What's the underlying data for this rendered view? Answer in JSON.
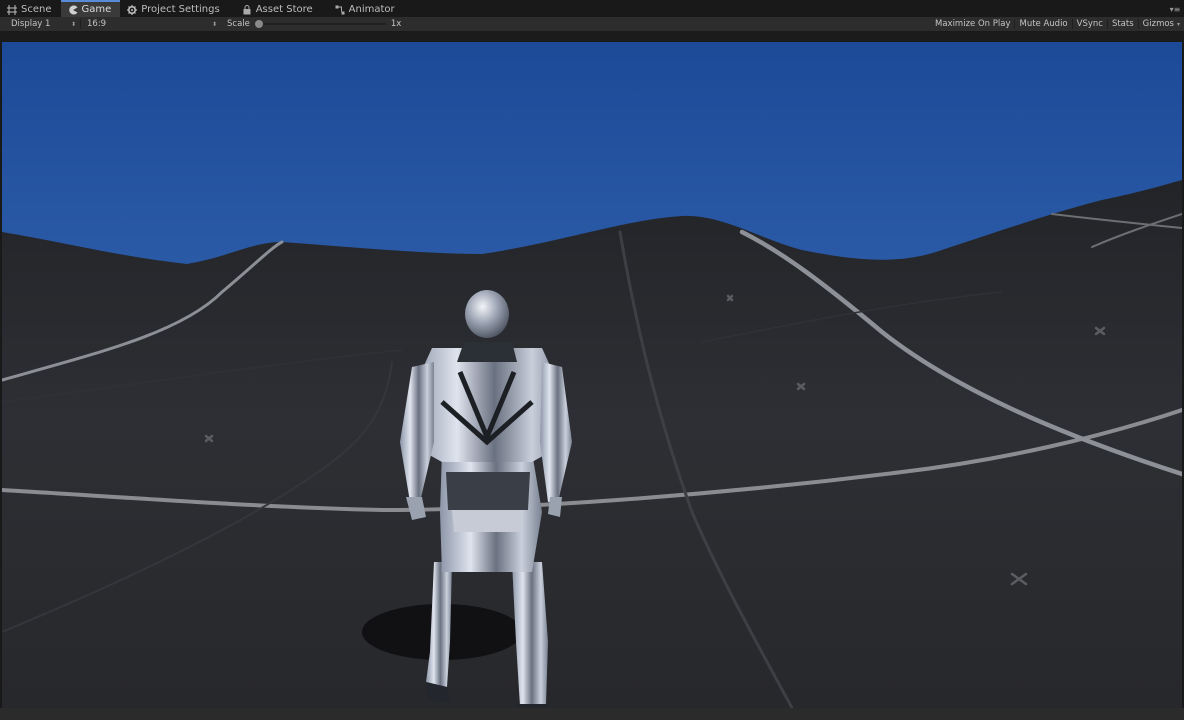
{
  "tabs": [
    {
      "label": "Scene",
      "icon": "grid-icon",
      "active": false
    },
    {
      "label": "Game",
      "icon": "pacman-icon",
      "active": true
    },
    {
      "label": "Project Settings",
      "icon": "gear-icon",
      "active": false
    },
    {
      "label": "Asset Store",
      "icon": "bag-icon",
      "active": false
    },
    {
      "label": "Animator",
      "icon": "animator-icon",
      "active": false
    }
  ],
  "toolbar": {
    "display": "Display 1",
    "aspect": "16:9",
    "scale_label": "Scale",
    "scale_value": "1x",
    "maximize": "Maximize On Play",
    "mute": "Mute Audio",
    "vsync": "VSync",
    "stats": "Stats",
    "gizmos": "Gizmos"
  },
  "colors": {
    "sky_top": "#1f4c9a",
    "sky_horizon": "#4c7ac0",
    "ground": "#2a2c30",
    "accent_tab": "#5a8ad8"
  }
}
